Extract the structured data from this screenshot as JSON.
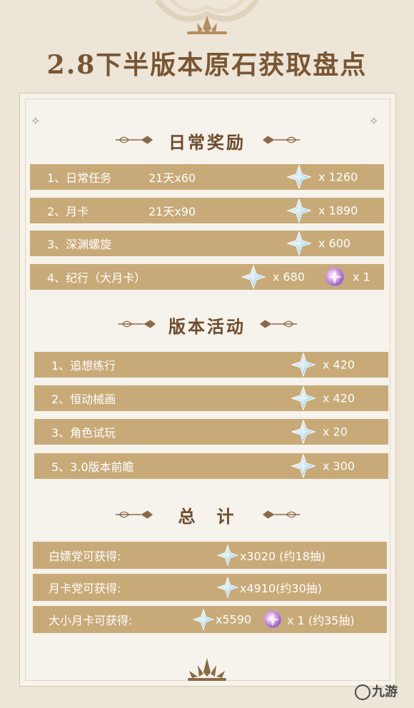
{
  "title": "2.8下半版本原石获取盘点",
  "sections": {
    "daily": "日常奖励",
    "events": "版本活动",
    "total": "总　计"
  },
  "daily": [
    {
      "label": "1、日常任务",
      "days": "21天x60",
      "amount": "x  1260"
    },
    {
      "label": "2、月卡",
      "days": "21天x90",
      "amount": "x  1890"
    },
    {
      "label": "3、深渊螺旋",
      "days": "",
      "amount": "x  600"
    },
    {
      "label": "4、纪行（大月卡）",
      "days": "",
      "amount": "x  680",
      "extra": "x  1"
    }
  ],
  "events": [
    {
      "label": "1、追想练行",
      "amount": "x  420"
    },
    {
      "label": "2、恒动械画",
      "amount": "x  420"
    },
    {
      "label": "3、角色试玩",
      "amount": "x  20"
    },
    {
      "label": "5、3.0版本前瞻",
      "amount": "x  300"
    }
  ],
  "totals": [
    {
      "label": "白嫖党可获得:",
      "amount": "x3020  (约18抽)"
    },
    {
      "label": "月卡党可获得:",
      "amount": "x4910(约30抽)"
    },
    {
      "label": "大小月卡可获得:",
      "amount": "x5590",
      "extra": "x 1  (约35抽)"
    }
  ],
  "logo_text": "九游",
  "colors": {
    "row_bg": "#c8aa78",
    "title": "#7a5532",
    "panel": "#f6f2ec"
  }
}
